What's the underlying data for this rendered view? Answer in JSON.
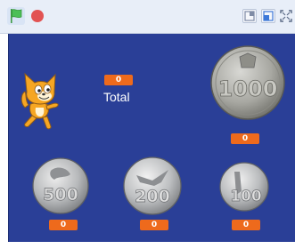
{
  "toolbar": {
    "green_flag_icon": "green-flag-icon",
    "stop_icon": "stop-icon",
    "small_stage_icon": "small-stage-icon",
    "normal_stage_icon": "normal-stage-icon",
    "fullscreen_icon": "fullscreen-icon"
  },
  "stage": {
    "background_color": "#2a3f97",
    "total": {
      "value": "0",
      "label": "Total"
    },
    "coins": [
      {
        "denomination": "1000",
        "count": "0"
      },
      {
        "denomination": "500",
        "count": "0"
      },
      {
        "denomination": "200",
        "count": "0"
      },
      {
        "denomination": "100",
        "count": "0"
      }
    ]
  },
  "colors": {
    "monitor": "#ee6a1c",
    "flag": "#4cbf56",
    "stop": "#e25353"
  }
}
